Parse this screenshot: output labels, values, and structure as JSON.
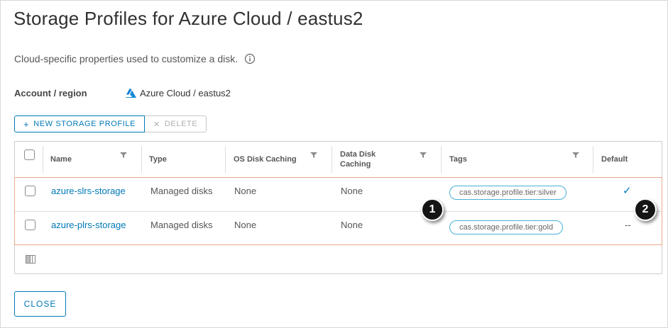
{
  "dialog": {
    "title": "Storage Profiles for Azure Cloud / eastus2",
    "description": "Cloud-specific properties used to customize a disk.",
    "info_icon": "info-circle-icon"
  },
  "account": {
    "label": "Account / region",
    "value": "Azure Cloud / eastus2",
    "icon": "azure-logo-icon"
  },
  "toolbar": {
    "new_label": "NEW STORAGE PROFILE",
    "delete_label": "DELETE"
  },
  "grid": {
    "columns": [
      {
        "label": "Name",
        "filterable": true
      },
      {
        "label": "Type",
        "filterable": false
      },
      {
        "label": "OS Disk Caching",
        "filterable": true
      },
      {
        "label": "Data Disk Caching",
        "filterable": true
      },
      {
        "label": "Tags",
        "filterable": true
      },
      {
        "label": "Default",
        "filterable": false
      }
    ],
    "rows": [
      {
        "name": "azure-slrs-storage",
        "type": "Managed disks",
        "os_disk_caching": "None",
        "data_disk_caching": "None",
        "tag": "cas.storage.profile.tier:silver",
        "default": "✓"
      },
      {
        "name": "azure-plrs-storage",
        "type": "Managed disks",
        "os_disk_caching": "None",
        "data_disk_caching": "None",
        "tag": "cas.storage.profile.tier:gold",
        "default": "--"
      }
    ]
  },
  "callouts": [
    "1",
    "2"
  ],
  "footer": {
    "close_label": "CLOSE"
  },
  "colors": {
    "accent": "#0079b8",
    "tag_border": "#49afd9",
    "selection_border": "#e9a98c",
    "check": "#0079b8"
  }
}
